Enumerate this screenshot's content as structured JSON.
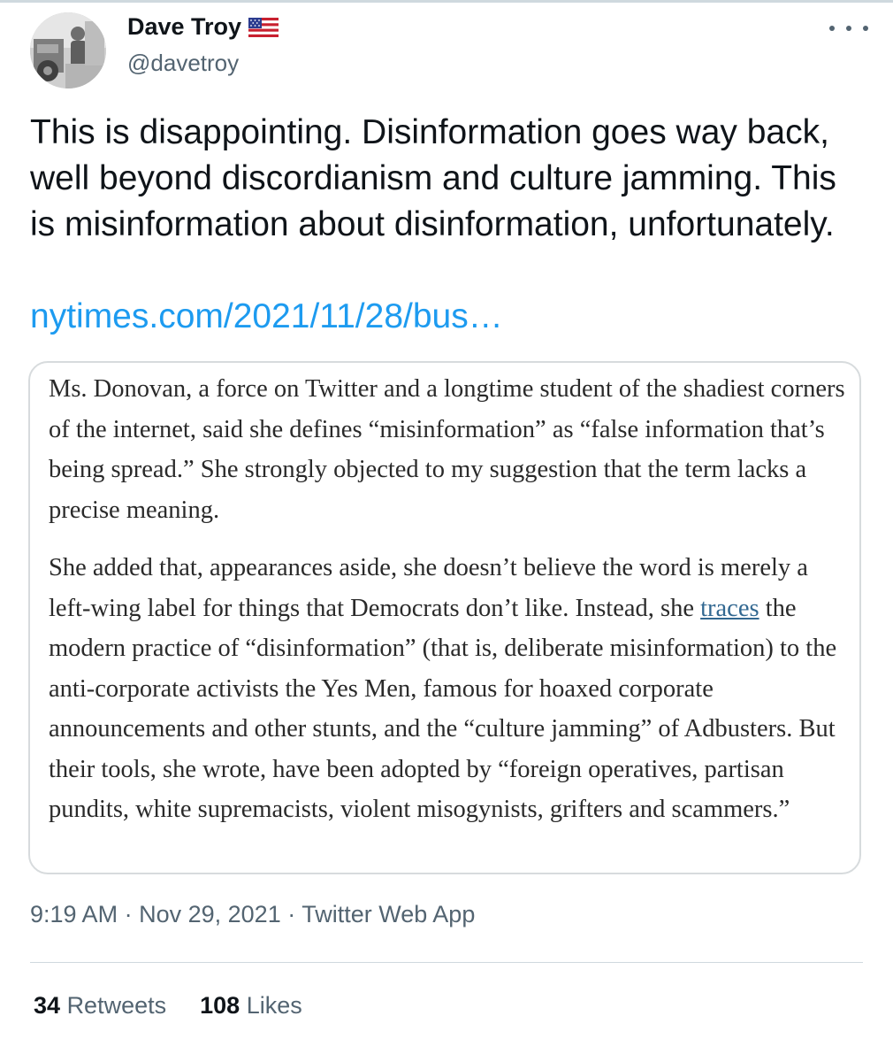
{
  "author": {
    "name": "Dave Troy",
    "handle": "@davetroy"
  },
  "tweet": {
    "text": "This is disappointing. Disinformation goes way back, well beyond discordianism and culture jamming. This is misinformation about disinformation, unfortunately.",
    "link_text": "nytimes.com/2021/11/28/bus…"
  },
  "quote": {
    "paragraph1": "Ms. Donovan, a force on Twitter and a longtime student of the shadiest corners of the internet, said she defines “misinformation” as “false information that’s being spread.” She strongly objected to my suggestion that the term lacks a precise meaning.",
    "paragraph2_before": "She added that, appearances aside, she doesn’t believe the word is merely a left-wing label for things that Democrats don’t like. Instead, she ",
    "paragraph2_link": "traces",
    "paragraph2_after": " the modern practice of “disinformation” (that is, deliberate misinformation) to the anti-corporate activists the Yes Men, famous for hoaxed corporate announcements and other stunts, and the “culture jamming” of Adbusters. But their tools, she wrote, have been adopted by “foreign operatives, partisan pundits, white supremacists, violent misogynists, grifters and scammers.”"
  },
  "meta": {
    "time": "9:19 AM",
    "separator": "·",
    "date": "Nov 29, 2021",
    "source": "Twitter Web App"
  },
  "stats": {
    "retweets_count": "34",
    "retweets_label": "Retweets",
    "likes_count": "108",
    "likes_label": "Likes"
  },
  "icons": {
    "flag": "us-flag-icon",
    "more": "more-options-icon"
  },
  "colors": {
    "link": "#1d9bf0",
    "secondary_text": "#536471",
    "article_link": "#326891"
  }
}
